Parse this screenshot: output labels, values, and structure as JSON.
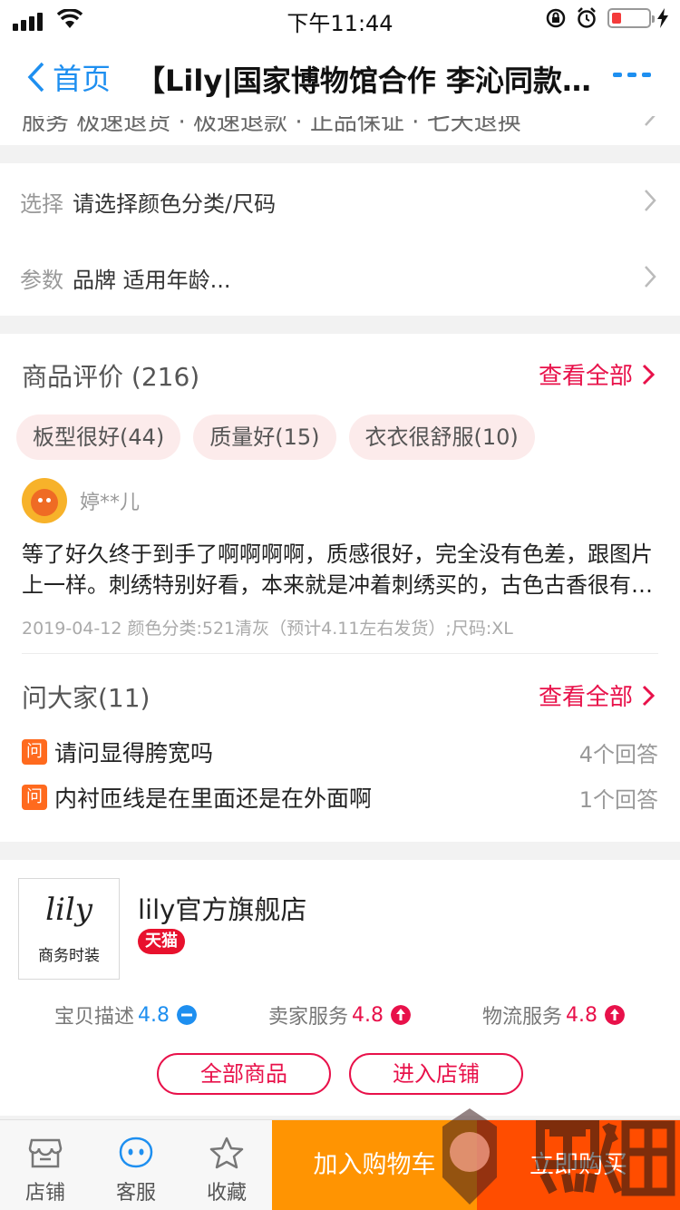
{
  "status_bar": {
    "time": "下午11:44"
  },
  "nav": {
    "back_label": "首页",
    "title": "【Lily|国家博物馆合作 李沁同款】2019夏新款女装刺绣仿真丝连衣裙"
  },
  "service": {
    "text": "服务  极速退货 · 极速退款 · 正品保证 · 七天退换"
  },
  "options": [
    {
      "label": "选择",
      "value": "请选择颜色分类/尺码"
    },
    {
      "label": "参数",
      "value": "品牌 适用年龄..."
    }
  ],
  "reviews": {
    "title": "商品评价 (216)",
    "see_all": "查看全部",
    "tags": [
      "板型很好(44)",
      "质量好(15)",
      "衣衣很舒服(10)"
    ],
    "reviewer_name": "婷**儿",
    "text": "等了好久终于到手了啊啊啊啊，质感很好，完全没有色差，跟图片上一样。刺绣特别好看，本来就是冲着刺绣买的，古色古香很有气质。",
    "meta": "2019-04-12 颜色分类:521清灰（预计4.11左右发货）;尺码:XL"
  },
  "qa": {
    "title": "问大家(11)",
    "see_all": "查看全部",
    "icon_label": "问",
    "items": [
      {
        "question": "请问显得胯宽吗",
        "answers": "4个回答"
      },
      {
        "question": "内衬匝线是在里面还是在外面啊",
        "answers": "1个回答"
      }
    ]
  },
  "shop": {
    "logo_script": "lily",
    "logo_sub": "商务时装",
    "name": "lily官方旗舰店",
    "badge": "天猫",
    "ratings": [
      {
        "label": "宝贝描述",
        "value": "4.8",
        "color": "#1e8ff0",
        "trend": "flat"
      },
      {
        "label": "卖家服务",
        "value": "4.8",
        "color": "#e8114a",
        "trend": "up"
      },
      {
        "label": "物流服务",
        "value": "4.8",
        "color": "#e8114a",
        "trend": "up"
      }
    ],
    "btn_all": "全部商品",
    "btn_enter": "进入店铺"
  },
  "tabbar": {
    "shop": "店铺",
    "service": "客服",
    "favorite": "收藏",
    "add_cart": "加入购物车",
    "buy_now": "立即购买"
  },
  "watermark": {
    "cn": "黑猫",
    "en": "BLACK CAT"
  },
  "colors": {
    "accent": "#e8114a",
    "link": "#1e8ff0",
    "cart": "#ff9402",
    "buy": "#ff4d00"
  }
}
